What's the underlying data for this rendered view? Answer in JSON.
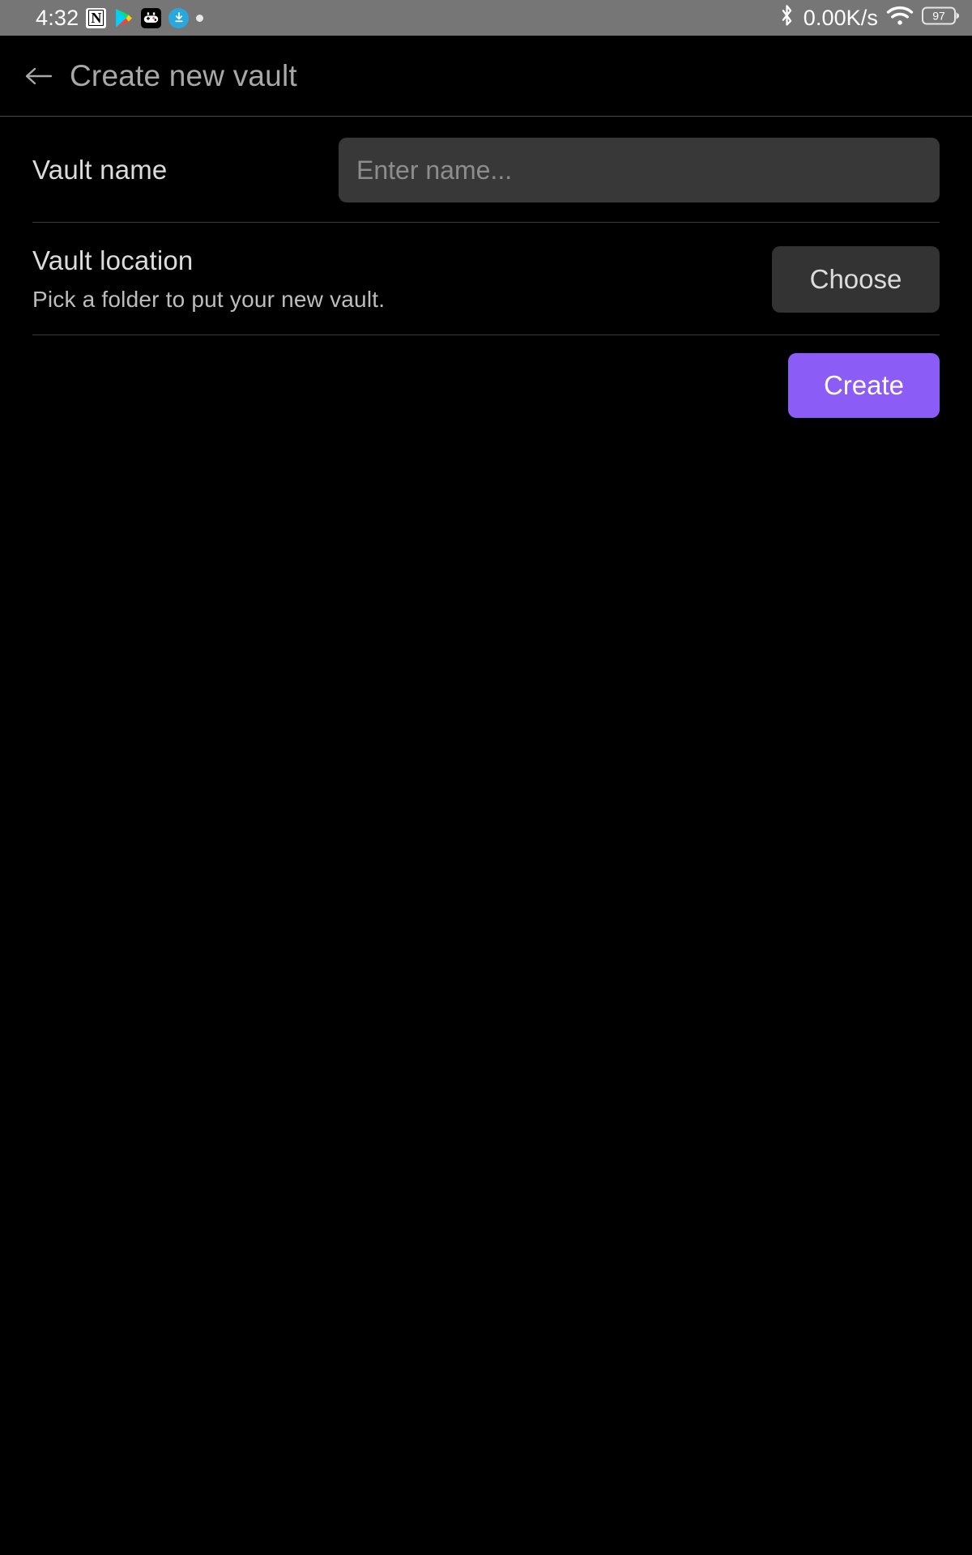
{
  "status_bar": {
    "clock": "4:32",
    "network_speed": "0.00K/s",
    "battery_level": "97",
    "icons": [
      "notion-icon",
      "google-play-icon",
      "game-controller-icon",
      "download-icon",
      "dot-indicator-icon",
      "bluetooth-icon",
      "wifi-icon",
      "battery-icon"
    ],
    "background_color": "#767676",
    "foreground_color": "#ffffff"
  },
  "header": {
    "back_icon": "arrow-left-icon",
    "title": "Create new vault"
  },
  "settings": [
    {
      "title": "Vault name",
      "description": "",
      "control": "text-input",
      "value": "",
      "placeholder": "Enter name..."
    },
    {
      "title": "Vault location",
      "description": "Pick a folder to put your new vault.",
      "control": "button",
      "button_label": "Choose"
    }
  ],
  "actions": {
    "create_label": "Create"
  },
  "colors": {
    "accent": "#8b5cf6",
    "background": "#000000",
    "input_background": "#383838",
    "button_background": "#333333",
    "divider": "#3a3a3a",
    "text_primary": "#dcdcdc",
    "text_secondary": "#bdbdbd",
    "text_muted": "#8d8d8d",
    "header_title": "#a8a8a8"
  }
}
